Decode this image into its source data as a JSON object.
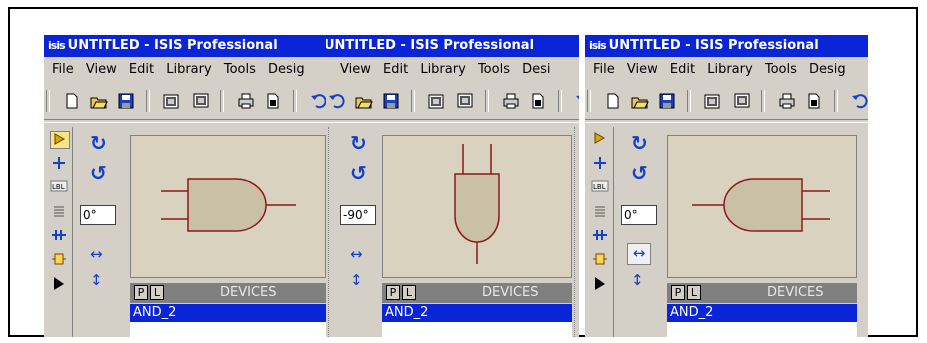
{
  "panels": [
    {
      "title": "UNTITLED - ISIS Professional",
      "logo": "isis",
      "menu": [
        "File",
        "View",
        "Edit",
        "Library",
        "Tools",
        "Desig"
      ],
      "angle": "0°",
      "devices_header": "DEVICES",
      "p_button": "P",
      "l_button": "L",
      "selected_device": "AND_2",
      "gate_orientation": "0°"
    },
    {
      "title": "UNTITLED - ISIS Professional",
      "menu": [
        "View",
        "Edit",
        "Library",
        "Tools",
        "Desi"
      ],
      "angle": "-90°",
      "devices_header": "DEVICES",
      "p_button": "P",
      "l_button": "L",
      "selected_device": "AND_2",
      "gate_orientation": "-90°"
    },
    {
      "title": "UNTITLED - ISIS Professional",
      "logo": "isis",
      "menu": [
        "File",
        "View",
        "Edit",
        "Library",
        "Tools",
        "Desig"
      ],
      "angle": "0°",
      "devices_header": "DEVICES",
      "p_button": "P",
      "l_button": "L",
      "selected_device": "AND_2",
      "gate_orientation": "mirrored"
    }
  ],
  "colors": {
    "title_bar": "#0a24d8",
    "gate_fill": "#c9c0a6",
    "gate_stroke": "#8b1a1a",
    "preview_bg": "#d8d2bf",
    "tool_blue": "#1540c8"
  },
  "icons": {
    "toolbar": [
      "new-file-icon",
      "open-folder-icon",
      "save-icon",
      "import-icon",
      "export-icon",
      "print-icon",
      "page-setup-icon",
      "undo-icon"
    ],
    "left_tools": [
      "component-mode-icon",
      "junction-icon",
      "label-icon",
      "text-script-icon",
      "bus-icon",
      "subcircuit-icon",
      "terminal-icon"
    ],
    "rotation": [
      "rotate-clockwise-icon",
      "rotate-anticlockwise-icon",
      "mirror-horizontal-icon",
      "mirror-vertical-icon"
    ]
  }
}
